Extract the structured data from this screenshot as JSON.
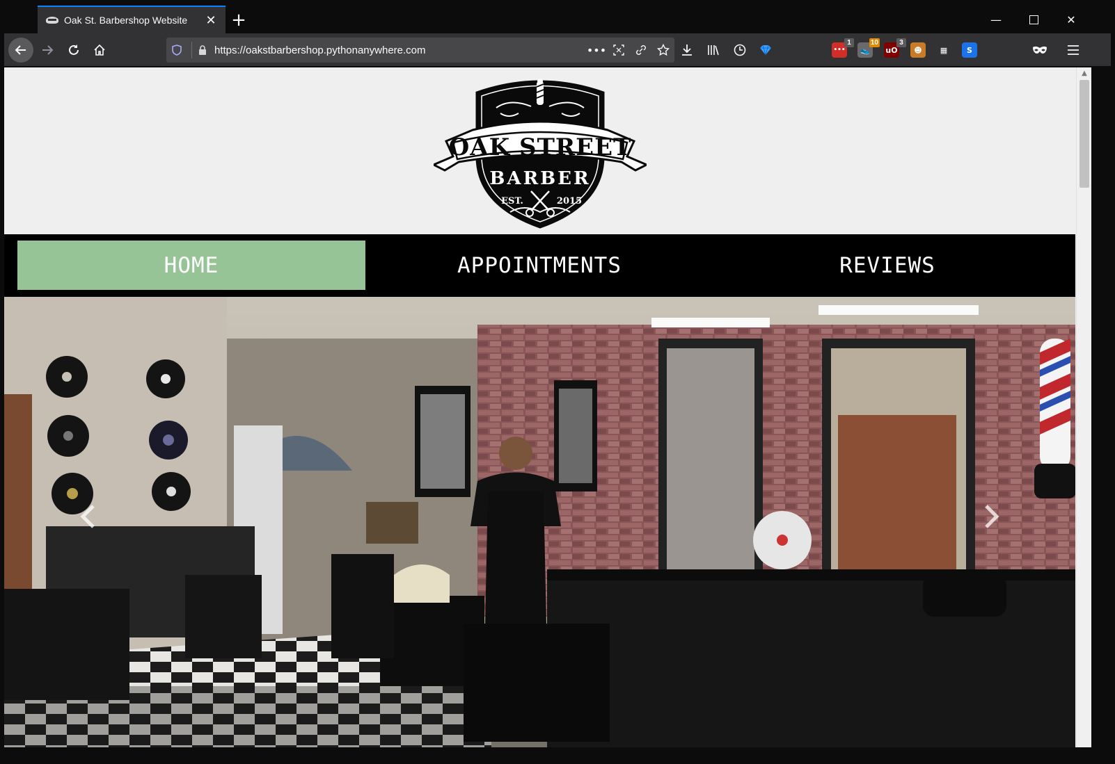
{
  "browser": {
    "tab_title": "Oak St. Barbershop Website",
    "url": "https://oakstbarbershop.pythonanywhere.com",
    "extensions": [
      {
        "name": "lastpass-icon",
        "badge": "1",
        "color": "#d32d27",
        "badge_color": "#5b5b5b"
      },
      {
        "name": "sneaker-extension-icon",
        "badge": "10",
        "color": "#6a6a6c",
        "badge_color": "#e08a00"
      },
      {
        "name": "ublock-icon",
        "badge": "3",
        "color": "#800000",
        "badge_color": "#5b5b5b"
      },
      {
        "name": "monkey-extension-icon",
        "badge": "",
        "color": "#c97b27",
        "badge_color": ""
      },
      {
        "name": "grid-extension-icon",
        "badge": "",
        "color": "#323234",
        "badge_color": ""
      },
      {
        "name": "s-extension-icon",
        "badge": "",
        "color": "#1a73e8",
        "badge_color": ""
      }
    ]
  },
  "site": {
    "logo": {
      "line1": "OAK STREET",
      "line2": "BARBER",
      "est_label": "EST.",
      "est_year": "2015"
    },
    "nav": {
      "items": [
        {
          "label": "HOME",
          "active": true
        },
        {
          "label": "APPOINTMENTS",
          "active": false
        },
        {
          "label": "REVIEWS",
          "active": false
        }
      ],
      "active_color": "#97c497"
    },
    "carousel": {
      "prev_icon": "chevron-left-icon",
      "next_icon": "chevron-right-icon"
    }
  }
}
